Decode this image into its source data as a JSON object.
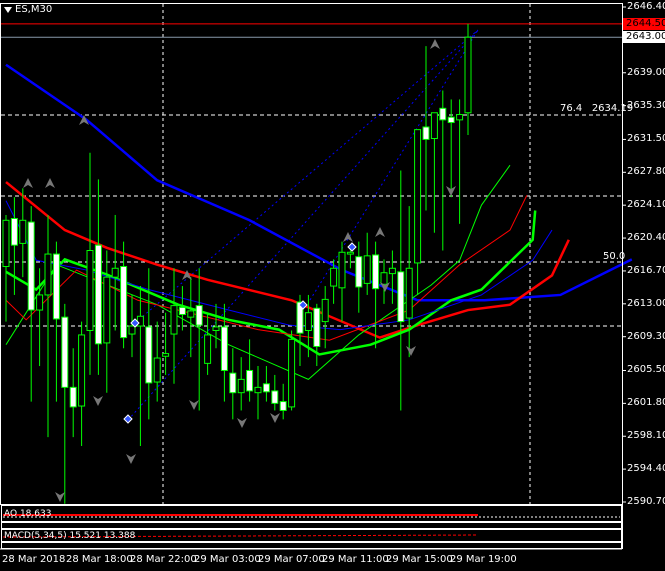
{
  "window": {
    "symbol_label": "ES,M30",
    "menu_icon": "triangle-down-icon"
  },
  "colors": {
    "background": "#000000",
    "bull_outline": "#00ff00",
    "bear_body": "#ffffff",
    "ma_blue": "#0000ff",
    "ma_red": "#ff0000",
    "ma_green": "#00ff00",
    "bid_tag": "#ff0000",
    "ask_tag": "#ffffff"
  },
  "price_axis": {
    "labels": [
      "2646.40",
      "2639.00",
      "2635.30",
      "2631.50",
      "2627.80",
      "2624.10",
      "2620.40",
      "2616.70",
      "2613.00",
      "2609.30",
      "2605.50",
      "2601.80",
      "2598.10",
      "2594.40",
      "2590.70"
    ],
    "bid": "2644.50",
    "ask": "2643.00"
  },
  "fibonacci": {
    "levels": [
      {
        "label": "76.4",
        "price_text": "2634.19"
      },
      {
        "label": "50.0",
        "price_text": ""
      }
    ]
  },
  "time_axis": [
    "28 Mar 2018",
    "28 Mar 18:00",
    "28 Mar 22:00",
    "29 Mar 03:00",
    "29 Mar 07:00",
    "29 Mar 11:00",
    "29 Mar 15:00",
    "29 Mar 19:00"
  ],
  "indicators": {
    "ao_label": "AO 18.633",
    "macd_label": "MACD(5,34,5) 15.521 13.388"
  },
  "candles": [
    [
      2617.2,
      2623,
      2611,
      2622.4
    ],
    [
      2622.6,
      2625,
      2614,
      2619.6
    ],
    [
      2619.8,
      2626,
      2616,
      2622.4
    ],
    [
      2622.2,
      2624,
      2602,
      2612.3
    ],
    [
      2612.3,
      2617,
      2606,
      2614
    ],
    [
      2614,
      2623,
      2598,
      2618.6
    ],
    [
      2618.6,
      2620,
      2602,
      2611.3
    ],
    [
      2611.5,
      2613,
      2590.5,
      2603.6
    ],
    [
      2603.6,
      2608,
      2598,
      2601.4
    ],
    [
      2601.5,
      2611,
      2597,
      2609.5
    ],
    [
      2610,
      2630,
      2605,
      2619
    ],
    [
      2619.6,
      2627,
      2605,
      2608.5
    ],
    [
      2608.6,
      2619,
      2603,
      2616
    ],
    [
      2616,
      2623,
      2610,
      2617
    ],
    [
      2617.2,
      2620,
      2608,
      2609.2
    ],
    [
      2609.6,
      2614,
      2607,
      2610.5
    ],
    [
      2610.5,
      2615,
      2597,
      2611.6
    ],
    [
      2610.4,
      2617,
      2600,
      2604.1
    ],
    [
      2604.2,
      2611,
      2602,
      2606.9
    ],
    [
      2607.1,
      2612,
      2605,
      2607.4
    ],
    [
      2609.6,
      2617,
      2604,
      2612.8
    ],
    [
      2612.6,
      2615,
      2610,
      2611.8
    ],
    [
      2611.5,
      2616,
      2607,
      2612.2
    ],
    [
      2612.8,
      2617,
      2601,
      2610.6
    ],
    [
      2606.3,
      2612,
      2605,
      2609.5
    ],
    [
      2610,
      2613,
      2608,
      2610.4
    ],
    [
      2610.4,
      2613,
      2602,
      2605.5
    ],
    [
      2605.2,
      2608,
      2600,
      2603
    ],
    [
      2603,
      2607,
      2601,
      2604.5
    ],
    [
      2605.5,
      2609,
      2602,
      2603.2
    ],
    [
      2603,
      2606,
      2600,
      2603.6
    ],
    [
      2604,
      2606,
      2602,
      2603.1
    ],
    [
      2603.2,
      2605,
      2601,
      2601.8
    ],
    [
      2602,
      2604,
      2600,
      2601
    ],
    [
      2601.4,
      2610,
      2601,
      2609
    ],
    [
      2613.2,
      2614,
      2606,
      2609.7
    ],
    [
      2610,
      2614,
      2607,
      2612
    ],
    [
      2612.5,
      2613,
      2606,
      2608.2
    ],
    [
      2611,
      2615,
      2608,
      2613.5
    ],
    [
      2615,
      2618,
      2613,
      2617
    ],
    [
      2614.8,
      2620,
      2611,
      2618.8
    ],
    [
      2618.6,
      2619,
      2617,
      2618.8
    ],
    [
      2618.3,
      2620,
      2612,
      2614.9
    ],
    [
      2615.3,
      2621,
      2614,
      2618.4
    ],
    [
      2618.5,
      2620,
      2608,
      2614.7
    ],
    [
      2615.2,
      2618,
      2613,
      2616.5
    ],
    [
      2616.4,
      2619,
      2613,
      2617
    ],
    [
      2616.6,
      2628,
      2601,
      2611
    ],
    [
      2611.4,
      2624,
      2607,
      2617
    ],
    [
      2617.6,
      2632.6,
      2614,
      2632.6
    ],
    [
      2632.9,
      2642,
      2623.5,
      2631.5
    ],
    [
      2631.6,
      2634.5,
      2621,
      2634.5
    ],
    [
      2635,
      2637,
      2619,
      2633.7
    ],
    [
      2634,
      2636,
      2625,
      2633.4
    ],
    [
      2633.7,
      2636,
      2622,
      2634.3
    ],
    [
      2634.5,
      2644.5,
      2632,
      2643
    ]
  ],
  "moving_averages": [
    {
      "color": "#0000ff",
      "width": 2.5,
      "points": [
        [
          0,
          2639.9
        ],
        [
          9.6,
          2633.7
        ],
        [
          18,
          2626.9
        ],
        [
          29,
          2622.4
        ],
        [
          40,
          2616.8
        ],
        [
          49,
          2613.4
        ],
        [
          57,
          2613.4
        ],
        [
          66,
          2614
        ],
        [
          74.5,
          2618
        ]
      ]
    },
    {
      "color": "#ff0000",
      "width": 2.5,
      "points": [
        [
          0,
          2626.7
        ],
        [
          7,
          2621.3
        ],
        [
          12,
          2619.3
        ],
        [
          18,
          2617.4
        ],
        [
          24,
          2615.7
        ],
        [
          34,
          2613.4
        ],
        [
          44.5,
          2609.2
        ],
        [
          49,
          2610.6
        ],
        [
          55,
          2612.3
        ],
        [
          60,
          2612.9
        ],
        [
          65,
          2616.2
        ],
        [
          67,
          2620.2
        ]
      ]
    },
    {
      "color": "#00ff00",
      "width": 2.5,
      "points": [
        [
          0,
          2616.6
        ],
        [
          3.6,
          2614.6
        ],
        [
          7,
          2618
        ],
        [
          12,
          2616.3
        ],
        [
          20.5,
          2612.9
        ],
        [
          26.5,
          2611.2
        ],
        [
          32.5,
          2610.1
        ],
        [
          37.3,
          2607.3
        ],
        [
          43.4,
          2608.4
        ],
        [
          48,
          2610.1
        ],
        [
          53,
          2613.4
        ],
        [
          56.6,
          2614.6
        ],
        [
          62.7,
          2620.2
        ],
        [
          63,
          2623.5
        ]
      ]
    },
    {
      "color": "#00ff00",
      "width": 1,
      "points": [
        [
          0,
          2608.4
        ],
        [
          6,
          2617.4
        ],
        [
          18,
          2612.9
        ],
        [
          26.5,
          2608.4
        ],
        [
          36,
          2604.5
        ],
        [
          42,
          2609.5
        ],
        [
          50.6,
          2615.1
        ],
        [
          54,
          2617.9
        ],
        [
          56.6,
          2624.1
        ],
        [
          60,
          2628.6
        ]
      ]
    },
    {
      "color": "#ff0000",
      "width": 1,
      "points": [
        [
          0,
          2613.4
        ],
        [
          2.4,
          2611.2
        ],
        [
          8.4,
          2616.8
        ],
        [
          15.7,
          2613.4
        ],
        [
          30,
          2610.1
        ],
        [
          38.5,
          2608.9
        ],
        [
          48,
          2612.3
        ],
        [
          54,
          2617.4
        ],
        [
          60,
          2621.3
        ],
        [
          62,
          2625.2
        ]
      ]
    },
    {
      "color": "#0000ff",
      "width": 1,
      "points": [
        [
          0,
          2624.6
        ],
        [
          3.6,
          2617.9
        ],
        [
          9.6,
          2616.8
        ],
        [
          17,
          2614.6
        ],
        [
          26.5,
          2612.3
        ],
        [
          33.7,
          2610.6
        ],
        [
          39.8,
          2610.1
        ],
        [
          48,
          2611.2
        ],
        [
          56.6,
          2614
        ],
        [
          62.7,
          2617.9
        ],
        [
          65,
          2621.3
        ]
      ]
    }
  ]
}
